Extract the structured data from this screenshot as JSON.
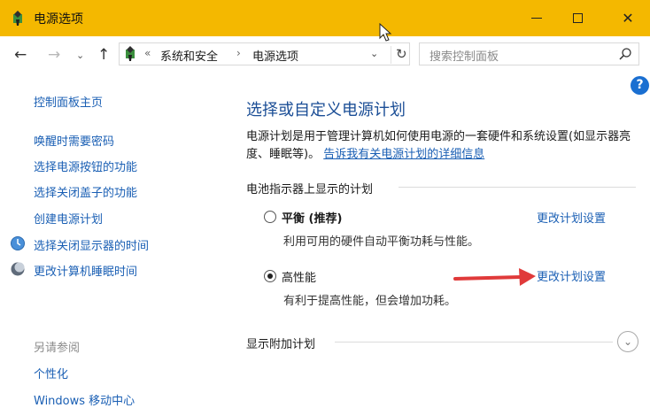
{
  "window": {
    "title": "电源选项",
    "accent": "#f4b800"
  },
  "navigation": {
    "back_icon": "←",
    "forward_icon": "→",
    "recent_icon": "⌄",
    "up_icon": "↑",
    "address": {
      "prefix": "«",
      "crumbs": [
        "系统和安全",
        "电源选项"
      ],
      "separator": "›",
      "dropdown": "⌄",
      "refresh": "↻"
    },
    "search_placeholder": "搜索控制面板"
  },
  "help_icon": "?",
  "sidebar": {
    "home": "控制面板主页",
    "links": [
      "唤醒时需要密码",
      "选择电源按钮的功能",
      "选择关闭盖子的功能",
      "创建电源计划",
      "选择关闭显示器的时间",
      "更改计算机睡眠时间"
    ],
    "see_also": "另请参阅",
    "related": [
      "个性化",
      "Windows 移动中心"
    ]
  },
  "main": {
    "title": "选择或自定义电源计划",
    "description": "电源计划是用于管理计算机如何使用电源的一套硬件和系统设置(如显示器亮度、睡眠等)。",
    "description_link": "告诉我有关电源计划的详细信息",
    "battery_section": "电池指示器上显示的计划",
    "plans": [
      {
        "name": "平衡 (推荐)",
        "description": "利用可用的硬件自动平衡功耗与性能。",
        "link": "更改计划设置",
        "selected": false
      },
      {
        "name": "高性能",
        "description": "有利于提高性能，但会增加功耗。",
        "link": "更改计划设置",
        "selected": true
      }
    ],
    "additional_section": "显示附加计划",
    "expand_icon": "⌄"
  },
  "colors": {
    "link": "#1a5fb4",
    "heading": "#1b4e96",
    "annotation_arrow": "#e03a3a"
  }
}
